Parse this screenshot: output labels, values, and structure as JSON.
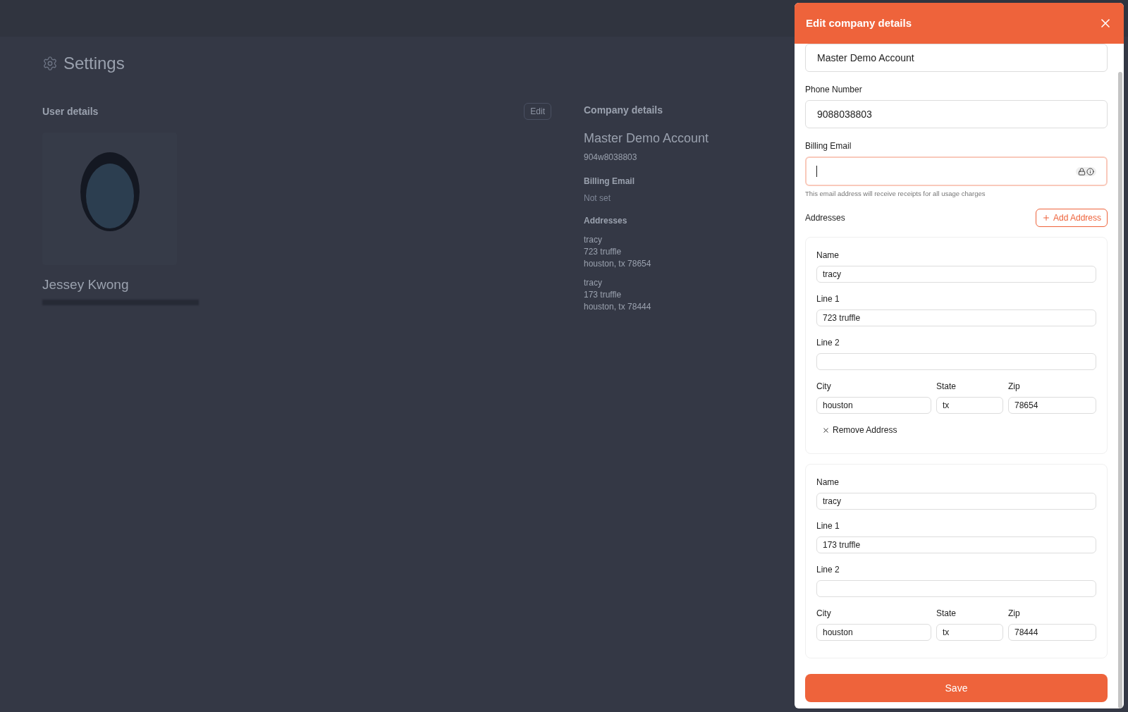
{
  "page": {
    "title": "Settings"
  },
  "user_details": {
    "heading": "User details",
    "edit_button": "Edit",
    "name": "Jessey Kwong"
  },
  "company_details": {
    "heading": "Company details",
    "name": "Master Demo Account",
    "phone": "904w8038803",
    "billing_email_label": "Billing Email",
    "billing_email_value": "Not set",
    "addresses_label": "Addresses",
    "addresses": [
      {
        "lines": [
          "tracy",
          "723 truffle",
          "houston, tx 78654"
        ]
      },
      {
        "lines": [
          "tracy",
          "173 truffle",
          "houston, tx 78444"
        ]
      }
    ]
  },
  "dialog": {
    "title": "Edit company details",
    "company_name": "Master Demo Account",
    "phone_label": "Phone Number",
    "phone": "9088038803",
    "billing_email_label": "Billing Email",
    "billing_email_focused": true,
    "billing_email_hint": "This email address will receive receipts for all usage charges",
    "addresses_label": "Addresses",
    "add_address": "Add Address",
    "addresses": [
      {
        "name_label": "Name",
        "name": "tracy",
        "line1_label": "Line 1",
        "line1": "723 truffle",
        "line2_label": "Line 2",
        "city_label": "City",
        "city": "houston",
        "state_label": "State",
        "state": "tx",
        "zip_label": "Zip",
        "zip": "78654",
        "remove": "Remove Address"
      },
      {
        "name_label": "Name",
        "name": "tracy",
        "line1_label": "Line 1",
        "line1": "173 truffle",
        "line2_label": "Line 2",
        "city_label": "City",
        "city": "houston",
        "state_label": "State",
        "state": "tx",
        "zip_label": "Zip",
        "zip": "78444"
      }
    ],
    "save": "Save"
  }
}
